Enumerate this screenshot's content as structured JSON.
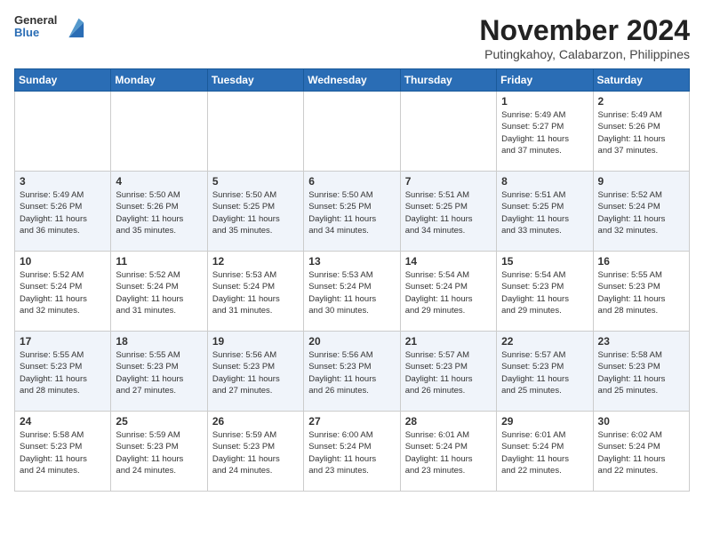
{
  "header": {
    "logo_line1": "General",
    "logo_line2": "Blue",
    "title": "November 2024",
    "subtitle": "Putingkahoy, Calabarzon, Philippines"
  },
  "weekdays": [
    "Sunday",
    "Monday",
    "Tuesday",
    "Wednesday",
    "Thursday",
    "Friday",
    "Saturday"
  ],
  "weeks": [
    [
      {
        "day": "",
        "info": ""
      },
      {
        "day": "",
        "info": ""
      },
      {
        "day": "",
        "info": ""
      },
      {
        "day": "",
        "info": ""
      },
      {
        "day": "",
        "info": ""
      },
      {
        "day": "1",
        "info": "Sunrise: 5:49 AM\nSunset: 5:27 PM\nDaylight: 11 hours\nand 37 minutes."
      },
      {
        "day": "2",
        "info": "Sunrise: 5:49 AM\nSunset: 5:26 PM\nDaylight: 11 hours\nand 37 minutes."
      }
    ],
    [
      {
        "day": "3",
        "info": "Sunrise: 5:49 AM\nSunset: 5:26 PM\nDaylight: 11 hours\nand 36 minutes."
      },
      {
        "day": "4",
        "info": "Sunrise: 5:50 AM\nSunset: 5:26 PM\nDaylight: 11 hours\nand 35 minutes."
      },
      {
        "day": "5",
        "info": "Sunrise: 5:50 AM\nSunset: 5:25 PM\nDaylight: 11 hours\nand 35 minutes."
      },
      {
        "day": "6",
        "info": "Sunrise: 5:50 AM\nSunset: 5:25 PM\nDaylight: 11 hours\nand 34 minutes."
      },
      {
        "day": "7",
        "info": "Sunrise: 5:51 AM\nSunset: 5:25 PM\nDaylight: 11 hours\nand 34 minutes."
      },
      {
        "day": "8",
        "info": "Sunrise: 5:51 AM\nSunset: 5:25 PM\nDaylight: 11 hours\nand 33 minutes."
      },
      {
        "day": "9",
        "info": "Sunrise: 5:52 AM\nSunset: 5:24 PM\nDaylight: 11 hours\nand 32 minutes."
      }
    ],
    [
      {
        "day": "10",
        "info": "Sunrise: 5:52 AM\nSunset: 5:24 PM\nDaylight: 11 hours\nand 32 minutes."
      },
      {
        "day": "11",
        "info": "Sunrise: 5:52 AM\nSunset: 5:24 PM\nDaylight: 11 hours\nand 31 minutes."
      },
      {
        "day": "12",
        "info": "Sunrise: 5:53 AM\nSunset: 5:24 PM\nDaylight: 11 hours\nand 31 minutes."
      },
      {
        "day": "13",
        "info": "Sunrise: 5:53 AM\nSunset: 5:24 PM\nDaylight: 11 hours\nand 30 minutes."
      },
      {
        "day": "14",
        "info": "Sunrise: 5:54 AM\nSunset: 5:24 PM\nDaylight: 11 hours\nand 29 minutes."
      },
      {
        "day": "15",
        "info": "Sunrise: 5:54 AM\nSunset: 5:23 PM\nDaylight: 11 hours\nand 29 minutes."
      },
      {
        "day": "16",
        "info": "Sunrise: 5:55 AM\nSunset: 5:23 PM\nDaylight: 11 hours\nand 28 minutes."
      }
    ],
    [
      {
        "day": "17",
        "info": "Sunrise: 5:55 AM\nSunset: 5:23 PM\nDaylight: 11 hours\nand 28 minutes."
      },
      {
        "day": "18",
        "info": "Sunrise: 5:55 AM\nSunset: 5:23 PM\nDaylight: 11 hours\nand 27 minutes."
      },
      {
        "day": "19",
        "info": "Sunrise: 5:56 AM\nSunset: 5:23 PM\nDaylight: 11 hours\nand 27 minutes."
      },
      {
        "day": "20",
        "info": "Sunrise: 5:56 AM\nSunset: 5:23 PM\nDaylight: 11 hours\nand 26 minutes."
      },
      {
        "day": "21",
        "info": "Sunrise: 5:57 AM\nSunset: 5:23 PM\nDaylight: 11 hours\nand 26 minutes."
      },
      {
        "day": "22",
        "info": "Sunrise: 5:57 AM\nSunset: 5:23 PM\nDaylight: 11 hours\nand 25 minutes."
      },
      {
        "day": "23",
        "info": "Sunrise: 5:58 AM\nSunset: 5:23 PM\nDaylight: 11 hours\nand 25 minutes."
      }
    ],
    [
      {
        "day": "24",
        "info": "Sunrise: 5:58 AM\nSunset: 5:23 PM\nDaylight: 11 hours\nand 24 minutes."
      },
      {
        "day": "25",
        "info": "Sunrise: 5:59 AM\nSunset: 5:23 PM\nDaylight: 11 hours\nand 24 minutes."
      },
      {
        "day": "26",
        "info": "Sunrise: 5:59 AM\nSunset: 5:23 PM\nDaylight: 11 hours\nand 24 minutes."
      },
      {
        "day": "27",
        "info": "Sunrise: 6:00 AM\nSunset: 5:24 PM\nDaylight: 11 hours\nand 23 minutes."
      },
      {
        "day": "28",
        "info": "Sunrise: 6:01 AM\nSunset: 5:24 PM\nDaylight: 11 hours\nand 23 minutes."
      },
      {
        "day": "29",
        "info": "Sunrise: 6:01 AM\nSunset: 5:24 PM\nDaylight: 11 hours\nand 22 minutes."
      },
      {
        "day": "30",
        "info": "Sunrise: 6:02 AM\nSunset: 5:24 PM\nDaylight: 11 hours\nand 22 minutes."
      }
    ]
  ]
}
